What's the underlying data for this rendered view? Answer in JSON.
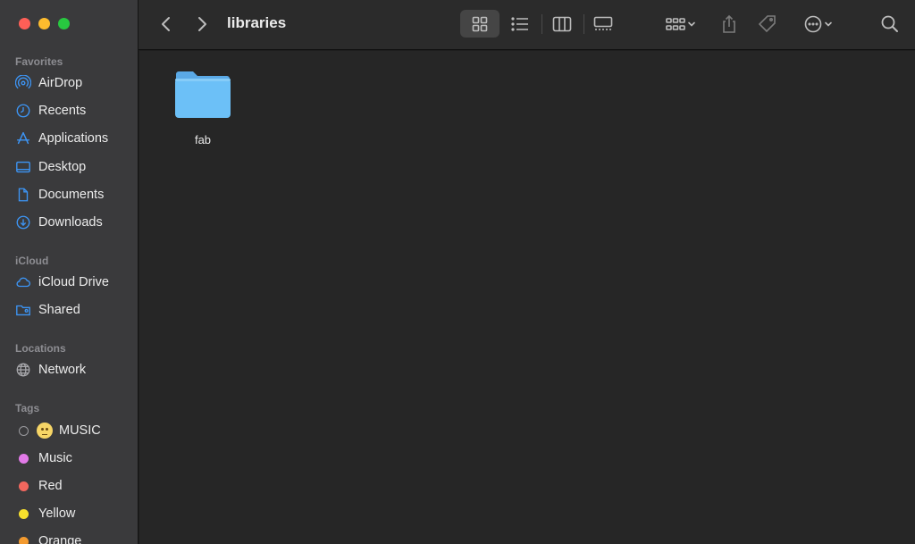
{
  "window": {
    "title": "libraries"
  },
  "sidebar": {
    "sections": {
      "favorites": "Favorites",
      "icloud": "iCloud",
      "locations": "Locations",
      "tags": "Tags"
    },
    "favorites": [
      {
        "label": "AirDrop",
        "icon": "airdrop-icon"
      },
      {
        "label": "Recents",
        "icon": "clock-icon"
      },
      {
        "label": "Applications",
        "icon": "applications-icon"
      },
      {
        "label": "Desktop",
        "icon": "desktop-icon"
      },
      {
        "label": "Documents",
        "icon": "document-icon"
      },
      {
        "label": "Downloads",
        "icon": "download-icon"
      }
    ],
    "icloud": [
      {
        "label": "iCloud Drive",
        "icon": "cloud-icon"
      },
      {
        "label": "Shared",
        "icon": "shared-folder-icon"
      }
    ],
    "locations": [
      {
        "label": "Network",
        "icon": "globe-icon"
      }
    ],
    "tags": [
      {
        "label": "MUSIC",
        "color": "none"
      },
      {
        "label": "Music",
        "color": "#e27ae8"
      },
      {
        "label": "Red",
        "color": "#f2675e"
      },
      {
        "label": "Yellow",
        "color": "#f7e02d"
      },
      {
        "label": "Orange",
        "color": "#f39a2f"
      }
    ]
  },
  "toolbar": {
    "back_icon": "chevron-left-icon",
    "forward_icon": "chevron-right-icon",
    "view_modes": [
      "icon-view",
      "list-view",
      "column-view",
      "gallery-view"
    ],
    "active_view": "icon-view"
  },
  "files": [
    {
      "name": "fab",
      "type": "folder",
      "icon": "folder-icon"
    }
  ],
  "colors": {
    "accent": "#2f8bf5",
    "folder": "#6cc0f7"
  }
}
